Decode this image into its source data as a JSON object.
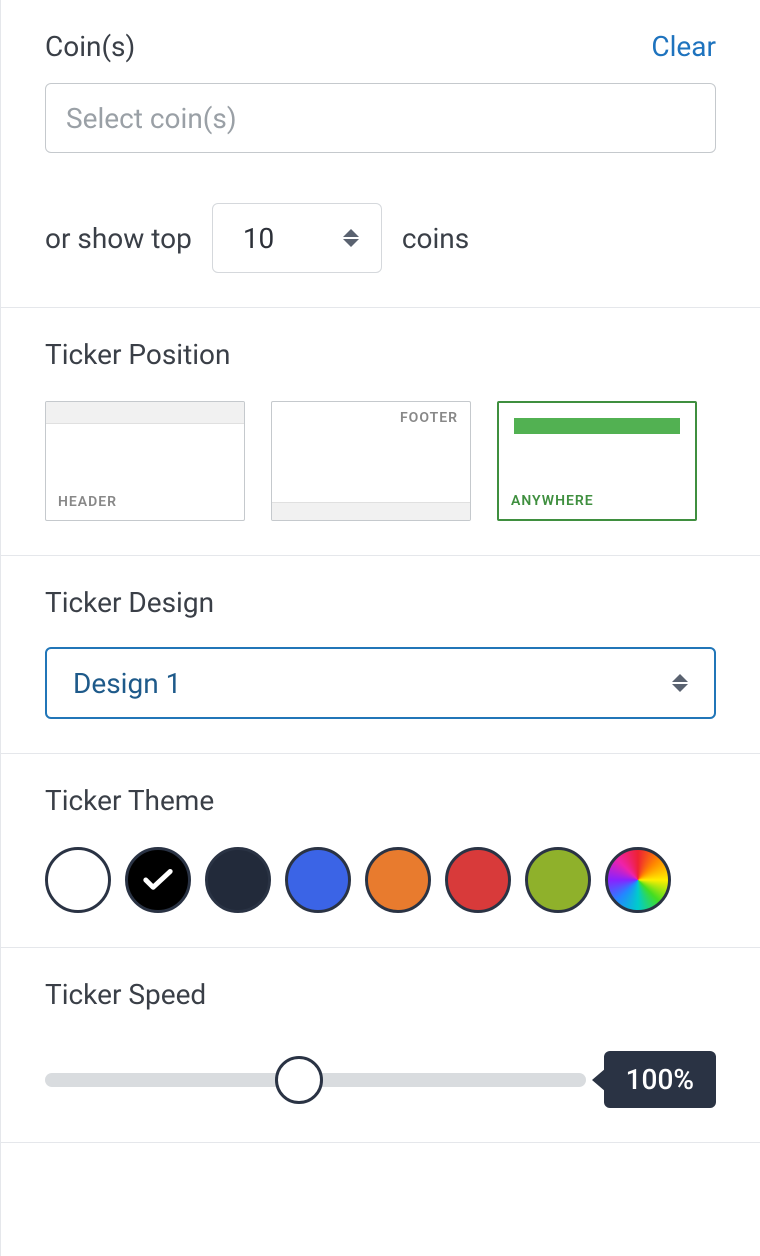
{
  "coins": {
    "label": "Coin(s)",
    "clear": "Clear",
    "placeholder": "Select coin(s)",
    "top_prefix": "or show top",
    "top_value": "10",
    "top_suffix": "coins"
  },
  "position": {
    "label": "Ticker Position",
    "options": {
      "header": "HEADER",
      "footer": "FOOTER",
      "anywhere": "ANYWHERE"
    },
    "selected": "anywhere"
  },
  "design": {
    "label": "Ticker Design",
    "selected": "Design 1"
  },
  "theme": {
    "label": "Ticker Theme",
    "selected": "black",
    "colors": {
      "white": "#ffffff",
      "black": "#000000",
      "navy": "#222a3a",
      "blue": "#3b64e6",
      "orange": "#e87b2e",
      "red": "#d83a3a",
      "olive": "#8fb12b",
      "rainbow": "multi"
    }
  },
  "speed": {
    "label": "Ticker Speed",
    "value": "100%"
  }
}
